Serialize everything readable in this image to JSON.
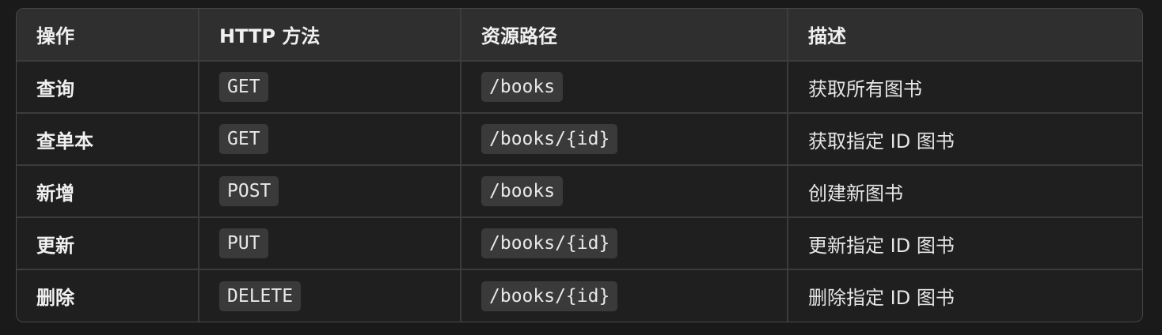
{
  "table": {
    "headers": [
      "操作",
      "HTTP 方法",
      "资源路径",
      "描述"
    ],
    "rows": [
      {
        "operation": "查询",
        "method": "GET",
        "path": "/books",
        "description": "获取所有图书"
      },
      {
        "operation": "查单本",
        "method": "GET",
        "path": "/books/{id}",
        "description": "获取指定 ID 图书"
      },
      {
        "operation": "新增",
        "method": "POST",
        "path": "/books",
        "description": "创建新图书"
      },
      {
        "operation": "更新",
        "method": "PUT",
        "path": "/books/{id}",
        "description": "更新指定 ID 图书"
      },
      {
        "operation": "删除",
        "method": "DELETE",
        "path": "/books/{id}",
        "description": "删除指定 ID 图书"
      }
    ]
  }
}
